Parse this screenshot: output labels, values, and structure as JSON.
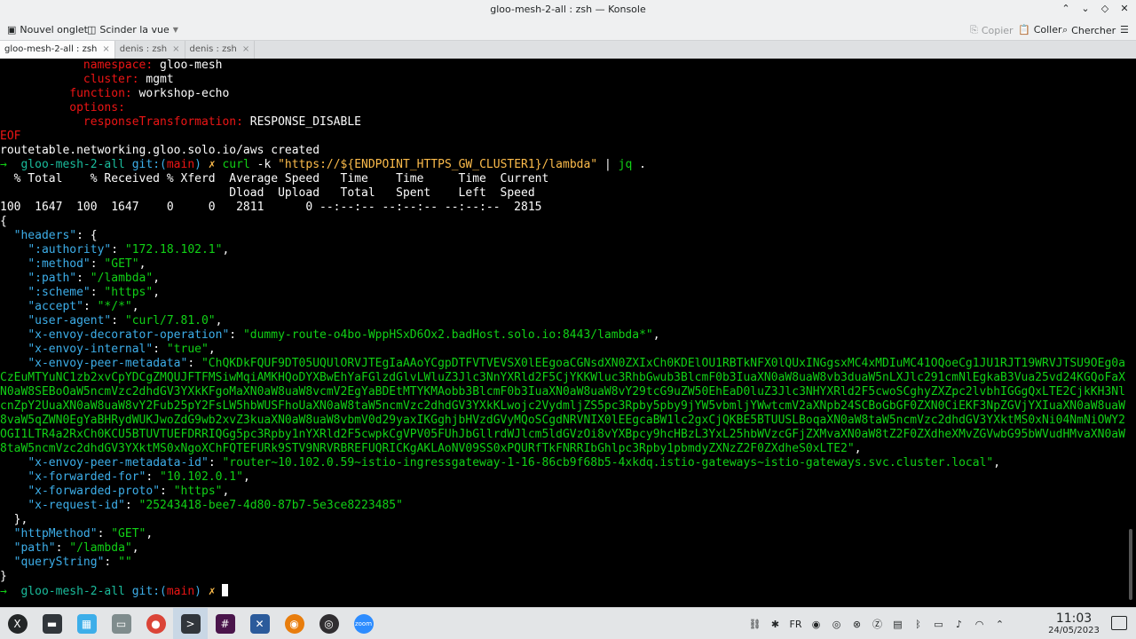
{
  "window": {
    "title": "gloo-mesh-2-all : zsh — Konsole"
  },
  "toolbar": {
    "new_tab": "Nouvel onglet",
    "split_view": "Scinder la vue",
    "copy": "Copier",
    "paste": "Coller",
    "find": "Chercher"
  },
  "tabs": [
    {
      "label": "gloo-mesh-2-all : zsh",
      "active": true
    },
    {
      "label": "denis : zsh",
      "active": false
    },
    {
      "label": "denis : zsh",
      "active": false
    }
  ],
  "terminal": {
    "lines": [
      [
        {
          "t": "            ",
          "c": "k-white"
        },
        {
          "t": "namespace:",
          "c": "k-red"
        },
        {
          "t": " gloo-mesh",
          "c": "k-white"
        }
      ],
      [
        {
          "t": "            ",
          "c": "k-white"
        },
        {
          "t": "cluster:",
          "c": "k-red"
        },
        {
          "t": " mgmt",
          "c": "k-white"
        }
      ],
      [
        {
          "t": "          ",
          "c": "k-white"
        },
        {
          "t": "function:",
          "c": "k-red"
        },
        {
          "t": " workshop-echo",
          "c": "k-white"
        }
      ],
      [
        {
          "t": "          ",
          "c": "k-white"
        },
        {
          "t": "options:",
          "c": "k-red"
        }
      ],
      [
        {
          "t": "            ",
          "c": "k-white"
        },
        {
          "t": "responseTransformation:",
          "c": "k-red"
        },
        {
          "t": " RESPONSE_DISABLE",
          "c": "k-white"
        }
      ],
      [
        {
          "t": "EOF",
          "c": "k-red"
        }
      ],
      [
        {
          "t": "routetable.networking.gloo.solo.io/aws created",
          "c": "k-white"
        }
      ],
      [
        {
          "t": "→  ",
          "c": "k-green"
        },
        {
          "t": "gloo-mesh-2-all ",
          "c": "k-cyan"
        },
        {
          "t": "git:(",
          "c": "k-blue"
        },
        {
          "t": "main",
          "c": "k-red"
        },
        {
          "t": ") ",
          "c": "k-blue"
        },
        {
          "t": "✗ ",
          "c": "k-yellow"
        },
        {
          "t": "curl",
          "c": "k-green"
        },
        {
          "t": " -k ",
          "c": "k-white"
        },
        {
          "t": "\"https://${ENDPOINT_HTTPS_GW_CLUSTER1}/lambda\"",
          "c": "k-yellow"
        },
        {
          "t": " | ",
          "c": "k-white"
        },
        {
          "t": "jq",
          "c": "k-green"
        },
        {
          "t": " .",
          "c": "k-white"
        }
      ],
      [
        {
          "t": "  % Total    % Received % Xferd  Average Speed   Time    Time     Time  Current",
          "c": "k-white"
        }
      ],
      [
        {
          "t": "                                 Dload  Upload   Total   Spent    Left  Speed",
          "c": "k-white"
        }
      ],
      [
        {
          "t": "100  1647  100  1647    0     0   2811      0 --:--:-- --:--:-- --:--:--  2815",
          "c": "k-white"
        }
      ],
      [
        {
          "t": "{",
          "c": "k-white"
        }
      ],
      [
        {
          "t": "  ",
          "c": "k-white"
        },
        {
          "t": "\"headers\"",
          "c": "k-blue"
        },
        {
          "t": ": {",
          "c": "k-white"
        }
      ],
      [
        {
          "t": "    ",
          "c": "k-white"
        },
        {
          "t": "\":authority\"",
          "c": "k-blue"
        },
        {
          "t": ": ",
          "c": "k-white"
        },
        {
          "t": "\"172.18.102.1\"",
          "c": "k-green"
        },
        {
          "t": ",",
          "c": "k-white"
        }
      ],
      [
        {
          "t": "    ",
          "c": "k-white"
        },
        {
          "t": "\":method\"",
          "c": "k-blue"
        },
        {
          "t": ": ",
          "c": "k-white"
        },
        {
          "t": "\"GET\"",
          "c": "k-green"
        },
        {
          "t": ",",
          "c": "k-white"
        }
      ],
      [
        {
          "t": "    ",
          "c": "k-white"
        },
        {
          "t": "\":path\"",
          "c": "k-blue"
        },
        {
          "t": ": ",
          "c": "k-white"
        },
        {
          "t": "\"/lambda\"",
          "c": "k-green"
        },
        {
          "t": ",",
          "c": "k-white"
        }
      ],
      [
        {
          "t": "    ",
          "c": "k-white"
        },
        {
          "t": "\":scheme\"",
          "c": "k-blue"
        },
        {
          "t": ": ",
          "c": "k-white"
        },
        {
          "t": "\"https\"",
          "c": "k-green"
        },
        {
          "t": ",",
          "c": "k-white"
        }
      ],
      [
        {
          "t": "    ",
          "c": "k-white"
        },
        {
          "t": "\"accept\"",
          "c": "k-blue"
        },
        {
          "t": ": ",
          "c": "k-white"
        },
        {
          "t": "\"*/*\"",
          "c": "k-green"
        },
        {
          "t": ",",
          "c": "k-white"
        }
      ],
      [
        {
          "t": "    ",
          "c": "k-white"
        },
        {
          "t": "\"user-agent\"",
          "c": "k-blue"
        },
        {
          "t": ": ",
          "c": "k-white"
        },
        {
          "t": "\"curl/7.81.0\"",
          "c": "k-green"
        },
        {
          "t": ",",
          "c": "k-white"
        }
      ],
      [
        {
          "t": "    ",
          "c": "k-white"
        },
        {
          "t": "\"x-envoy-decorator-operation\"",
          "c": "k-blue"
        },
        {
          "t": ": ",
          "c": "k-white"
        },
        {
          "t": "\"dummy-route-o4bo-WppHSxD6Ox2.badHost.solo.io:8443/lambda*\"",
          "c": "k-green"
        },
        {
          "t": ",",
          "c": "k-white"
        }
      ],
      [
        {
          "t": "    ",
          "c": "k-white"
        },
        {
          "t": "\"x-envoy-internal\"",
          "c": "k-blue"
        },
        {
          "t": ": ",
          "c": "k-white"
        },
        {
          "t": "\"true\"",
          "c": "k-green"
        },
        {
          "t": ",",
          "c": "k-white"
        }
      ]
    ],
    "peer_metadata_key": "\"x-envoy-peer-metadata\"",
    "peer_metadata_value": "\"ChQKDkFQUF9DT05UQUlORVJTEgIaAAoYCgpDTFVTVEVSX0lEEgoaCGNsdXN0ZXIxCh0KDElOU1RBTkNFX0lQUxINGgsxMC4xMDIuMC41OQoeCg1JU1RJT19WRVJTSU9OEg0aCzEuMTYuNC1zb2xvCpYDCgZMQUJFTFMSiwMqiAMKHQoDYXBwEhYaFGlzdGlvLWluZ3Jlc3NnYXRld2F5CjYKKWluc3RhbGwub3BlcmF0b3IuaXN0aW8uaW8vb3duaW5nLXJlc291cmNlEgkaB3Vua25vd24KGQoFaXN0aW8SEBoOaW5ncmVzc2dhdGV3YXkKFgoMaXN0aW8uaW8vcmV2EgYaBDEtMTYKMAobb3BlcmF0b3IuaXN0aW8uaW8vY29tcG9uZW50EhEaD0luZ3Jlc3NHYXRld2F5cwoSCghyZXZpc2lvbhIGGgQxLTE2CjkKH3NlcnZpY2UuaXN0aW8uaW8vY2Fub25pY2FsLW5hbWUSFhoUaXN0aW8taW5ncmVzc2dhdGV3YXkKLwojc2VydmljZS5pc3Rpby5pby9jYW5vbmljYWwtcmV2aXNpb24SCBoGbGF0ZXN0CiEKF3NpZGVjYXIuaXN0aW8uaW8vaW5qZWN0EgYaBHRydWUKJwoZdG9wb2xvZ3kuaXN0aW8uaW8vbmV0d29yaxIKGghjbHVzdGVyMQoSCgdNRVNIX0lEEgcaBW1lc2gxCjQKBE5BTUUSLBoqaXN0aW8taW5ncmVzc2dhdGV3YXktMS0xNi04NmNiOWY2OGI1LTR4a2RxCh0KCU5BTUVTUEFDRRIQGg5pc3Rpby1nYXRld2F5cwpkCgVPV05FUhJbGllrdWJlcm5ldGVzOi8vYXBpcy9hcHBzL3YxL25hbWVzcGFjZXMvaXN0aW8tZ2F0ZXdheXMvZGVwbG95bWVudHMvaXN0aW8taW5ncmVzc2dhdGV3YXktMS0xNgoXChFQTEFURk9STV9NRVRBREFUQRICKgAKLAoNV09SS0xPQURfTkFNRRIbGhlpc3Rpby1pbmdyZXNzZ2F0ZXdheS0xLTE2\"",
    "lines_after": [
      [
        {
          "t": "    ",
          "c": "k-white"
        },
        {
          "t": "\"x-envoy-peer-metadata-id\"",
          "c": "k-blue"
        },
        {
          "t": ": ",
          "c": "k-white"
        },
        {
          "t": "\"router~10.102.0.59~istio-ingressgateway-1-16-86cb9f68b5-4xkdq.istio-gateways~istio-gateways.svc.cluster.local\"",
          "c": "k-green"
        },
        {
          "t": ",",
          "c": "k-white"
        }
      ],
      [
        {
          "t": "    ",
          "c": "k-white"
        },
        {
          "t": "\"x-forwarded-for\"",
          "c": "k-blue"
        },
        {
          "t": ": ",
          "c": "k-white"
        },
        {
          "t": "\"10.102.0.1\"",
          "c": "k-green"
        },
        {
          "t": ",",
          "c": "k-white"
        }
      ],
      [
        {
          "t": "    ",
          "c": "k-white"
        },
        {
          "t": "\"x-forwarded-proto\"",
          "c": "k-blue"
        },
        {
          "t": ": ",
          "c": "k-white"
        },
        {
          "t": "\"https\"",
          "c": "k-green"
        },
        {
          "t": ",",
          "c": "k-white"
        }
      ],
      [
        {
          "t": "    ",
          "c": "k-white"
        },
        {
          "t": "\"x-request-id\"",
          "c": "k-blue"
        },
        {
          "t": ": ",
          "c": "k-white"
        },
        {
          "t": "\"25243418-bee7-4d80-87b7-5e3ce8223485\"",
          "c": "k-green"
        }
      ],
      [
        {
          "t": "  },",
          "c": "k-white"
        }
      ],
      [
        {
          "t": "  ",
          "c": "k-white"
        },
        {
          "t": "\"httpMethod\"",
          "c": "k-blue"
        },
        {
          "t": ": ",
          "c": "k-white"
        },
        {
          "t": "\"GET\"",
          "c": "k-green"
        },
        {
          "t": ",",
          "c": "k-white"
        }
      ],
      [
        {
          "t": "  ",
          "c": "k-white"
        },
        {
          "t": "\"path\"",
          "c": "k-blue"
        },
        {
          "t": ": ",
          "c": "k-white"
        },
        {
          "t": "\"/lambda\"",
          "c": "k-green"
        },
        {
          "t": ",",
          "c": "k-white"
        }
      ],
      [
        {
          "t": "  ",
          "c": "k-white"
        },
        {
          "t": "\"queryString\"",
          "c": "k-blue"
        },
        {
          "t": ": ",
          "c": "k-white"
        },
        {
          "t": "\"\"",
          "c": "k-green"
        }
      ],
      [
        {
          "t": "}",
          "c": "k-white"
        }
      ],
      [
        {
          "t": "→  ",
          "c": "k-green"
        },
        {
          "t": "gloo-mesh-2-all ",
          "c": "k-cyan"
        },
        {
          "t": "git:(",
          "c": "k-blue"
        },
        {
          "t": "main",
          "c": "k-red"
        },
        {
          "t": ") ",
          "c": "k-blue"
        },
        {
          "t": "✗ ",
          "c": "k-yellow"
        }
      ]
    ]
  },
  "taskbar": {
    "apps": [
      "app-launcher-icon",
      "terminal-icon",
      "files-icon",
      "file-manager-icon",
      "chrome-icon",
      "konsole-icon",
      "slack-icon",
      "vscode-icon",
      "blender-icon",
      "obs-icon",
      "zoom-icon"
    ],
    "zoom_label": "zoom",
    "keyboard_layout": "FR",
    "time": "11:03",
    "date": "24/05/2023"
  }
}
